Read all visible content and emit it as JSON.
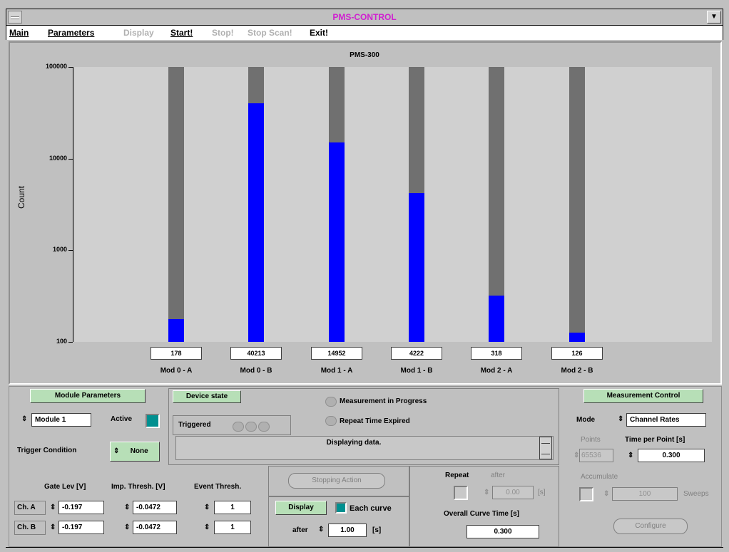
{
  "window": {
    "title": "PMS-CONTROL",
    "minimize_icon": "triangle-down-icon"
  },
  "menu": {
    "main": "Main",
    "parameters": "Parameters",
    "display": "Display",
    "start": "Start!",
    "stop": "Stop!",
    "stop_scan": "Stop Scan!",
    "exit": "Exit!"
  },
  "chart_data": {
    "type": "bar",
    "title": "PMS-300",
    "ylabel": "Count",
    "yscale": "log",
    "ylim": [
      100,
      100000
    ],
    "yticks": [
      "100000",
      "10000",
      "1000",
      "100"
    ],
    "categories": [
      "Mod 0 - A",
      "Mod 0 - B",
      "Mod 1 - A",
      "Mod 1 - B",
      "Mod 2 - A",
      "Mod 2 - B"
    ],
    "values": [
      178,
      40213,
      14952,
      4222,
      318,
      126
    ],
    "value_labels": [
      "178",
      "40213",
      "14952",
      "4222",
      "318",
      "126"
    ],
    "bar_color": "#0000ff",
    "background_bar_color": "#707070",
    "grid": false
  },
  "module_params": {
    "header": "Module Parameters",
    "module": "Module 1",
    "active_label": "Active",
    "active_checked": true,
    "trigger_label": "Trigger Condition",
    "trigger_value": "None",
    "gate_header": "Gate Lev [V]",
    "imp_header": "Imp. Thresh. [V]",
    "event_header": "Event Thresh.",
    "ch_a": {
      "label": "Ch. A",
      "gate": "-0.197",
      "imp": "-0.0472",
      "event": "1"
    },
    "ch_b": {
      "label": "Ch. B",
      "gate": "-0.197",
      "imp": "-0.0472",
      "event": "1"
    }
  },
  "device_state": {
    "header": "Device state",
    "triggered_label": "Triggered",
    "measurement_label": "Measurement  in Progress",
    "repeat_expired_label": "Repeat Time Expired",
    "status_text": "Displaying data."
  },
  "actions": {
    "stopping": "Stopping Action",
    "display": "Display",
    "each_curve": "Each curve",
    "after_label": "after",
    "after_value": "1.00",
    "after_unit": "[s]"
  },
  "repeat": {
    "label": "Repeat",
    "after_label": "after",
    "value": "0.00",
    "unit": "[s]",
    "overall_label": "Overall Curve Time [s]",
    "overall_value": "0.300"
  },
  "measurement": {
    "header": "Measurement Control",
    "mode_label": "Mode",
    "mode_value": "Channel Rates",
    "points_label": "Points",
    "points_value": "65536",
    "time_label": "Time per Point [s]",
    "time_value": "0.300",
    "accumulate_label": "Accumulate",
    "accumulate_value": "100",
    "sweeps_label": "Sweeps",
    "configure": "Configure"
  }
}
